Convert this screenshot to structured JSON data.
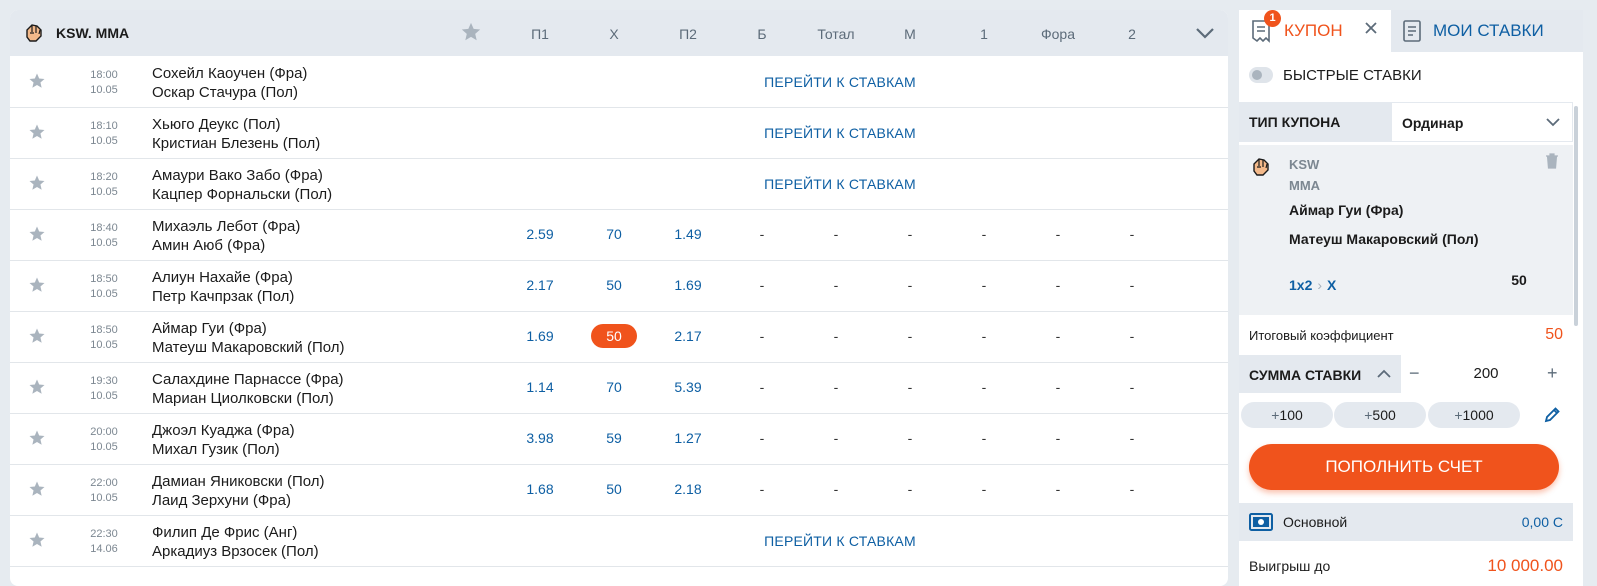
{
  "header": {
    "league": "KSW. MMA",
    "columns": [
      "П1",
      "Х",
      "П2",
      "Б",
      "Тотал",
      "М",
      "1",
      "Фора",
      "2"
    ]
  },
  "events": [
    {
      "time": "18:00",
      "date": "10.05",
      "team1": "Сохейл Каоучен (Фра)",
      "team2": "Оскар Стачура (Пол)",
      "link": "ПЕРЕЙТИ К СТАВКАМ"
    },
    {
      "time": "18:10",
      "date": "10.05",
      "team1": "Хьюго Деукс (Пол)",
      "team2": "Кристиан Блезень (Пол)",
      "link": "ПЕРЕЙТИ К СТАВКАМ"
    },
    {
      "time": "18:20",
      "date": "10.05",
      "team1": "Амаури Вако Забо (Фра)",
      "team2": "Кацпер Форнальски (Пол)",
      "link": "ПЕРЕЙТИ К СТАВКАМ"
    },
    {
      "time": "18:40",
      "date": "10.05",
      "team1": "Михаэль Лебот (Фра)",
      "team2": "Амин Аюб (Фра)",
      "odds": [
        "2.59",
        "70",
        "1.49",
        "-",
        "-",
        "-",
        "-",
        "-",
        "-"
      ]
    },
    {
      "time": "18:50",
      "date": "10.05",
      "team1": "Алиун Нахайе (Фра)",
      "team2": "Петр Качпрзак (Пол)",
      "odds": [
        "2.17",
        "50",
        "1.69",
        "-",
        "-",
        "-",
        "-",
        "-",
        "-"
      ]
    },
    {
      "time": "18:50",
      "date": "10.05",
      "team1": "Аймар Гуи (Фра)",
      "team2": "Матеуш Макаровский (Пол)",
      "odds": [
        "1.69",
        "50",
        "2.17",
        "-",
        "-",
        "-",
        "-",
        "-",
        "-"
      ],
      "selected_col": 1
    },
    {
      "time": "19:30",
      "date": "10.05",
      "team1": "Салахдине Парнассе (Фра)",
      "team2": "Мариан Циолковски (Пол)",
      "odds": [
        "1.14",
        "70",
        "5.39",
        "-",
        "-",
        "-",
        "-",
        "-",
        "-"
      ]
    },
    {
      "time": "20:00",
      "date": "10.05",
      "team1": "Джоэл Куаджа (Фра)",
      "team2": "Михал Гузик (Пол)",
      "odds": [
        "3.98",
        "59",
        "1.27",
        "-",
        "-",
        "-",
        "-",
        "-",
        "-"
      ]
    },
    {
      "time": "22:00",
      "date": "10.05",
      "team1": "Дамиан Яниковски (Пол)",
      "team2": "Лаид Зерхуни (Фра)",
      "odds": [
        "1.68",
        "50",
        "2.18",
        "-",
        "-",
        "-",
        "-",
        "-",
        "-"
      ]
    },
    {
      "time": "22:30",
      "date": "14.06",
      "team1": "Филип Де Фрис (Анг)",
      "team2": "Аркадиуз Врзосек (Пол)",
      "link": "ПЕРЕЙТИ К СТАВКАМ"
    }
  ],
  "coupon": {
    "tab_coupon": "КУПОН",
    "badge": "1",
    "tab_bets": "МОИ СТАВКИ",
    "quick_bets": "БЫСТРЫЕ СТАВКИ",
    "coupon_type_label": "ТИП КУПОНА",
    "coupon_type_value": "Ординар",
    "bet": {
      "league_line1": "KSW",
      "league_line2": "MMA",
      "team1": "Аймар Гуи (Фра)",
      "team2": "Матеуш Макаровский (Пол)",
      "market": "1x2",
      "separator": "›",
      "outcome": "Х",
      "odd": "50"
    },
    "total_label": "Итоговый коэффициент",
    "total_value": "50",
    "amount_label": "СУММА СТАВКИ",
    "minus": "−",
    "amount_value": "200",
    "plus": "+",
    "quick_add": [
      "100",
      "500",
      "1000"
    ],
    "quick_add_prefix": "+",
    "topup": "ПОПОЛНИТЬ СЧЕТ",
    "account_label": "Основной",
    "account_value": "0,00 С",
    "win_label": "Выигрыш до",
    "win_value": "10 000.00"
  },
  "colors": {
    "accent": "#f0531c",
    "link": "#0e5fa3",
    "header_bg": "#e4e9ef"
  }
}
